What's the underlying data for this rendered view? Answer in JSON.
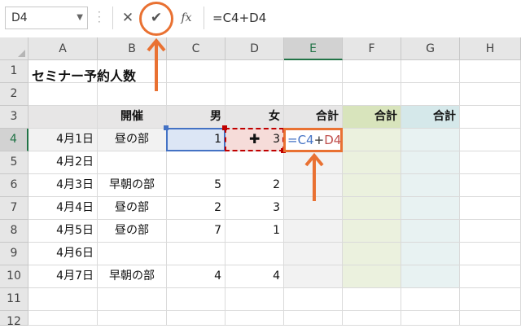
{
  "formula_bar": {
    "name_box": "D4",
    "name_box_dropdown_icon": "chevron-down-icon",
    "cancel_icon": "close-icon",
    "enter_icon": "checkmark-icon",
    "function_label": "fx",
    "formula": "=C4+D4"
  },
  "columns": [
    "A",
    "B",
    "C",
    "D",
    "E",
    "F",
    "G",
    "H"
  ],
  "rows": [
    "1",
    "2",
    "3",
    "4",
    "5",
    "6",
    "7",
    "8",
    "9",
    "10",
    "11",
    "12"
  ],
  "title": "セミナー予約人数",
  "headers": {
    "b": "開催",
    "c": "男",
    "d": "女",
    "e": "合計",
    "f": "合計",
    "g": "合計"
  },
  "table_rows": [
    {
      "a": "4月1日",
      "b": "昼の部",
      "c": "1",
      "d": "3"
    },
    {
      "a": "4月2日",
      "b": "",
      "c": "",
      "d": ""
    },
    {
      "a": "4月3日",
      "b": "早朝の部",
      "c": "5",
      "d": "2"
    },
    {
      "a": "4月4日",
      "b": "昼の部",
      "c": "2",
      "d": "3"
    },
    {
      "a": "4月5日",
      "b": "昼の部",
      "c": "7",
      "d": "1"
    },
    {
      "a": "4月6日",
      "b": "",
      "c": "",
      "d": ""
    },
    {
      "a": "4月7日",
      "b": "早朝の部",
      "c": "4",
      "d": "4"
    }
  ],
  "editing": {
    "cell": "E4",
    "prefix": "=",
    "ref1": "C4",
    "op": "+",
    "ref2": "D4"
  },
  "colors": {
    "accent": "#e97132",
    "col_e_fill": "#f2f2f2",
    "col_e_header": "#e7e6e6",
    "col_f_fill": "#ebf1de",
    "col_f_header": "#d8e4bc",
    "col_g_fill": "#e8f2f2",
    "col_g_header": "#d5e8ea",
    "header_row": "#e7e6e6",
    "excel_green": "#217346"
  }
}
